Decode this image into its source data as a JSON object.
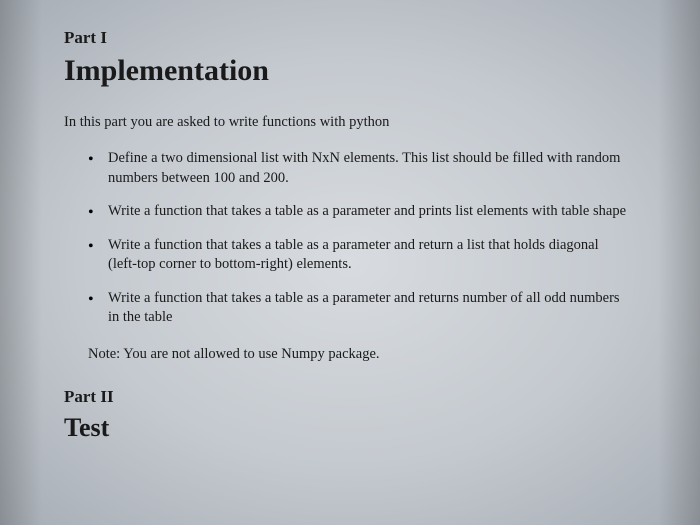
{
  "part1": {
    "label": "Part I",
    "title": "Implementation",
    "intro": "In this part you are asked to write functions with python",
    "bullets": [
      "Define a two dimensional list with NxN elements. This list should be filled with random numbers between 100 and 200.",
      "Write a function that takes a table as a parameter and prints list elements with table shape",
      "Write a function that takes a table as a parameter and return a list that holds diagonal (left-top corner to bottom-right) elements.",
      "Write a function that takes a table as a parameter and returns number of all odd numbers in the table"
    ],
    "note": "Note: You are not allowed to use Numpy package."
  },
  "part2": {
    "label": "Part II",
    "title": "Test"
  }
}
